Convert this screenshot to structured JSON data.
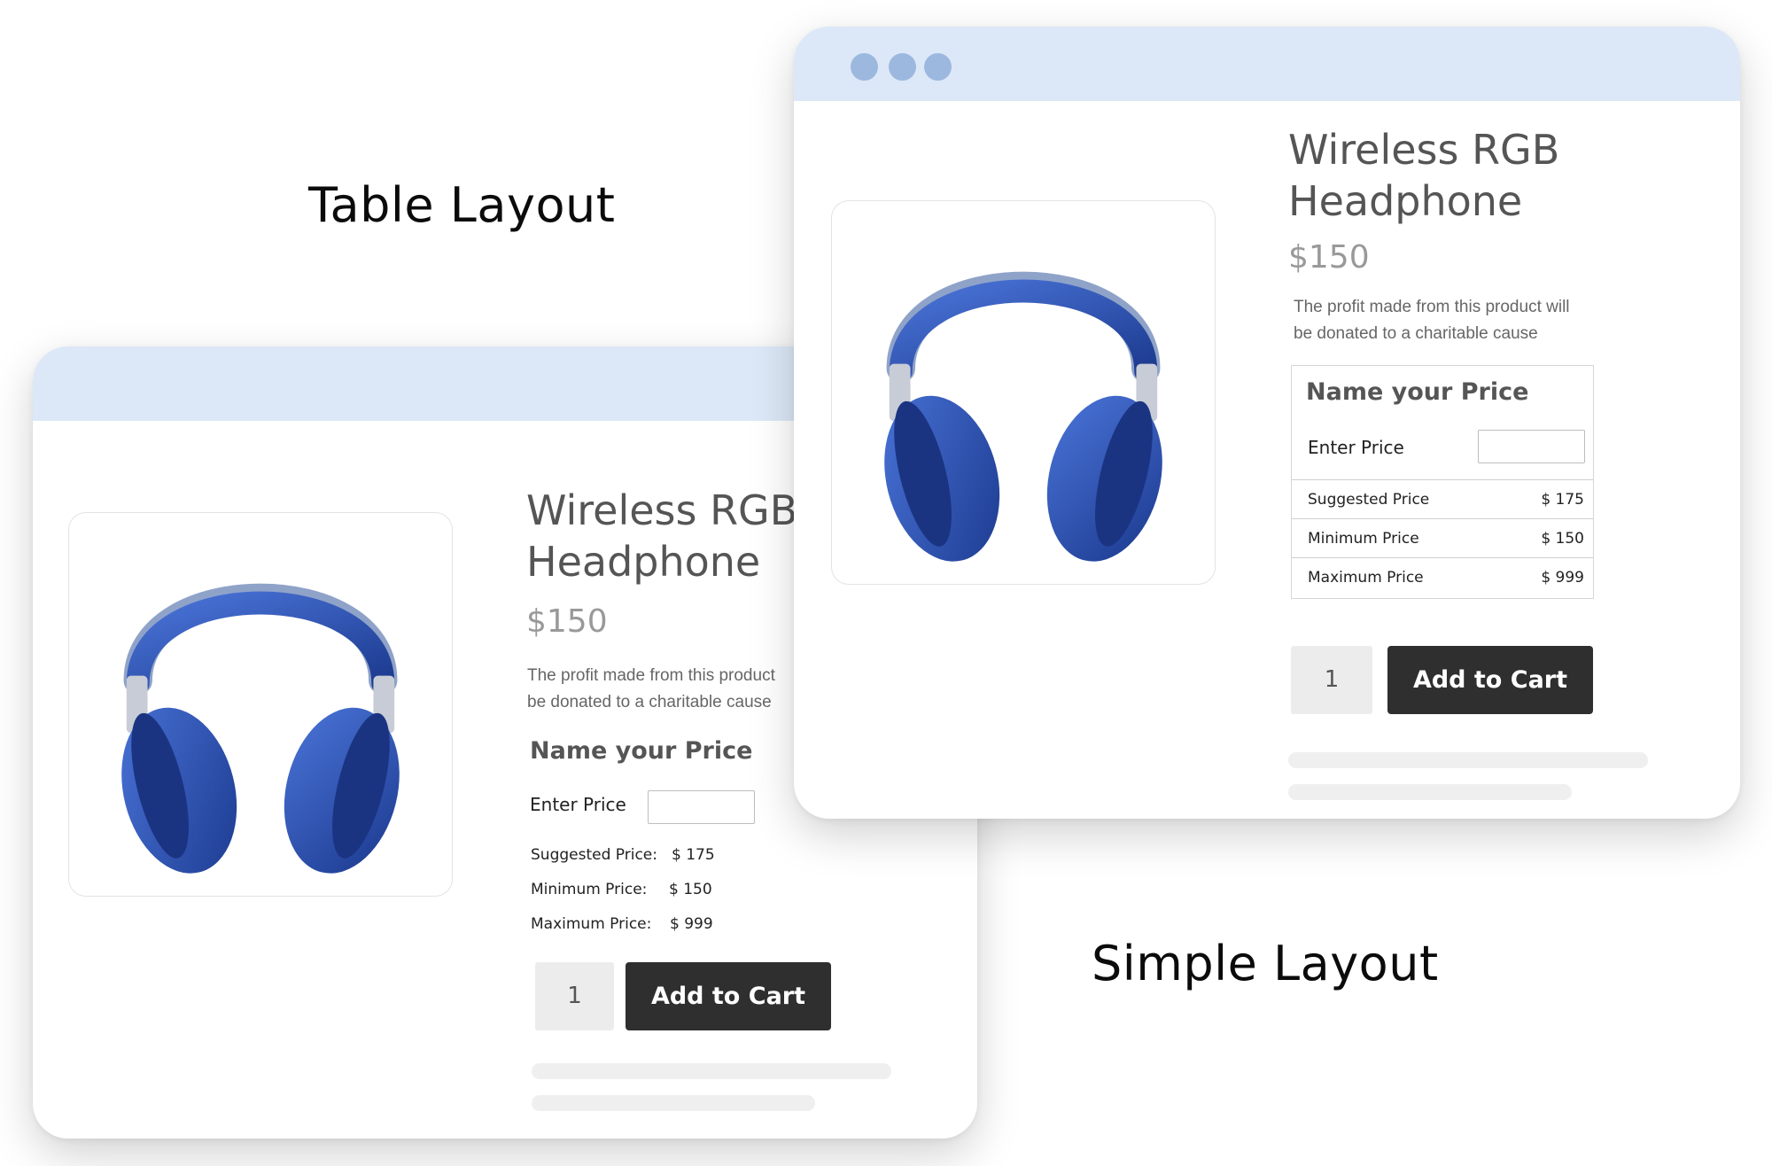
{
  "captions": {
    "table_layout": "Table Layout",
    "simple_layout": "Simple Layout"
  },
  "product": {
    "title_line1": "Wireless RGB",
    "title_line2": "Headphone",
    "price": "$150",
    "desc_line1": "The profit made from this product will",
    "desc_line2": "be donated to a charitable cause",
    "image_icon": "headphones-icon"
  },
  "table_window": {
    "desc_line1": "The profit made from this product",
    "desc_line2": "be donated to a charitable cause",
    "name_your_price": "Name your Price",
    "enter_price_label": "Enter Price",
    "rows": [
      {
        "label": "Suggested Price:",
        "value": "$ 175"
      },
      {
        "label": "Minimum Price:",
        "value": "$ 150"
      },
      {
        "label": "Maximum Price:",
        "value": "$ 999"
      }
    ],
    "quantity": "1",
    "add_to_cart": "Add to Cart"
  },
  "simple_window": {
    "name_your_price": "Name your Price",
    "enter_price_label": "Enter Price",
    "rows": [
      {
        "label": "Suggested Price",
        "value": "$ 175"
      },
      {
        "label": "Minimum Price",
        "value": "$ 150"
      },
      {
        "label": "Maximum Price",
        "value": "$ 999"
      }
    ],
    "quantity": "1",
    "add_to_cart": "Add to Cart"
  },
  "colors": {
    "titlebar": "#dce8f7",
    "dots": "#9cb8df",
    "button": "#2f2f2f",
    "headphone_blue": "#2a4fb0"
  }
}
